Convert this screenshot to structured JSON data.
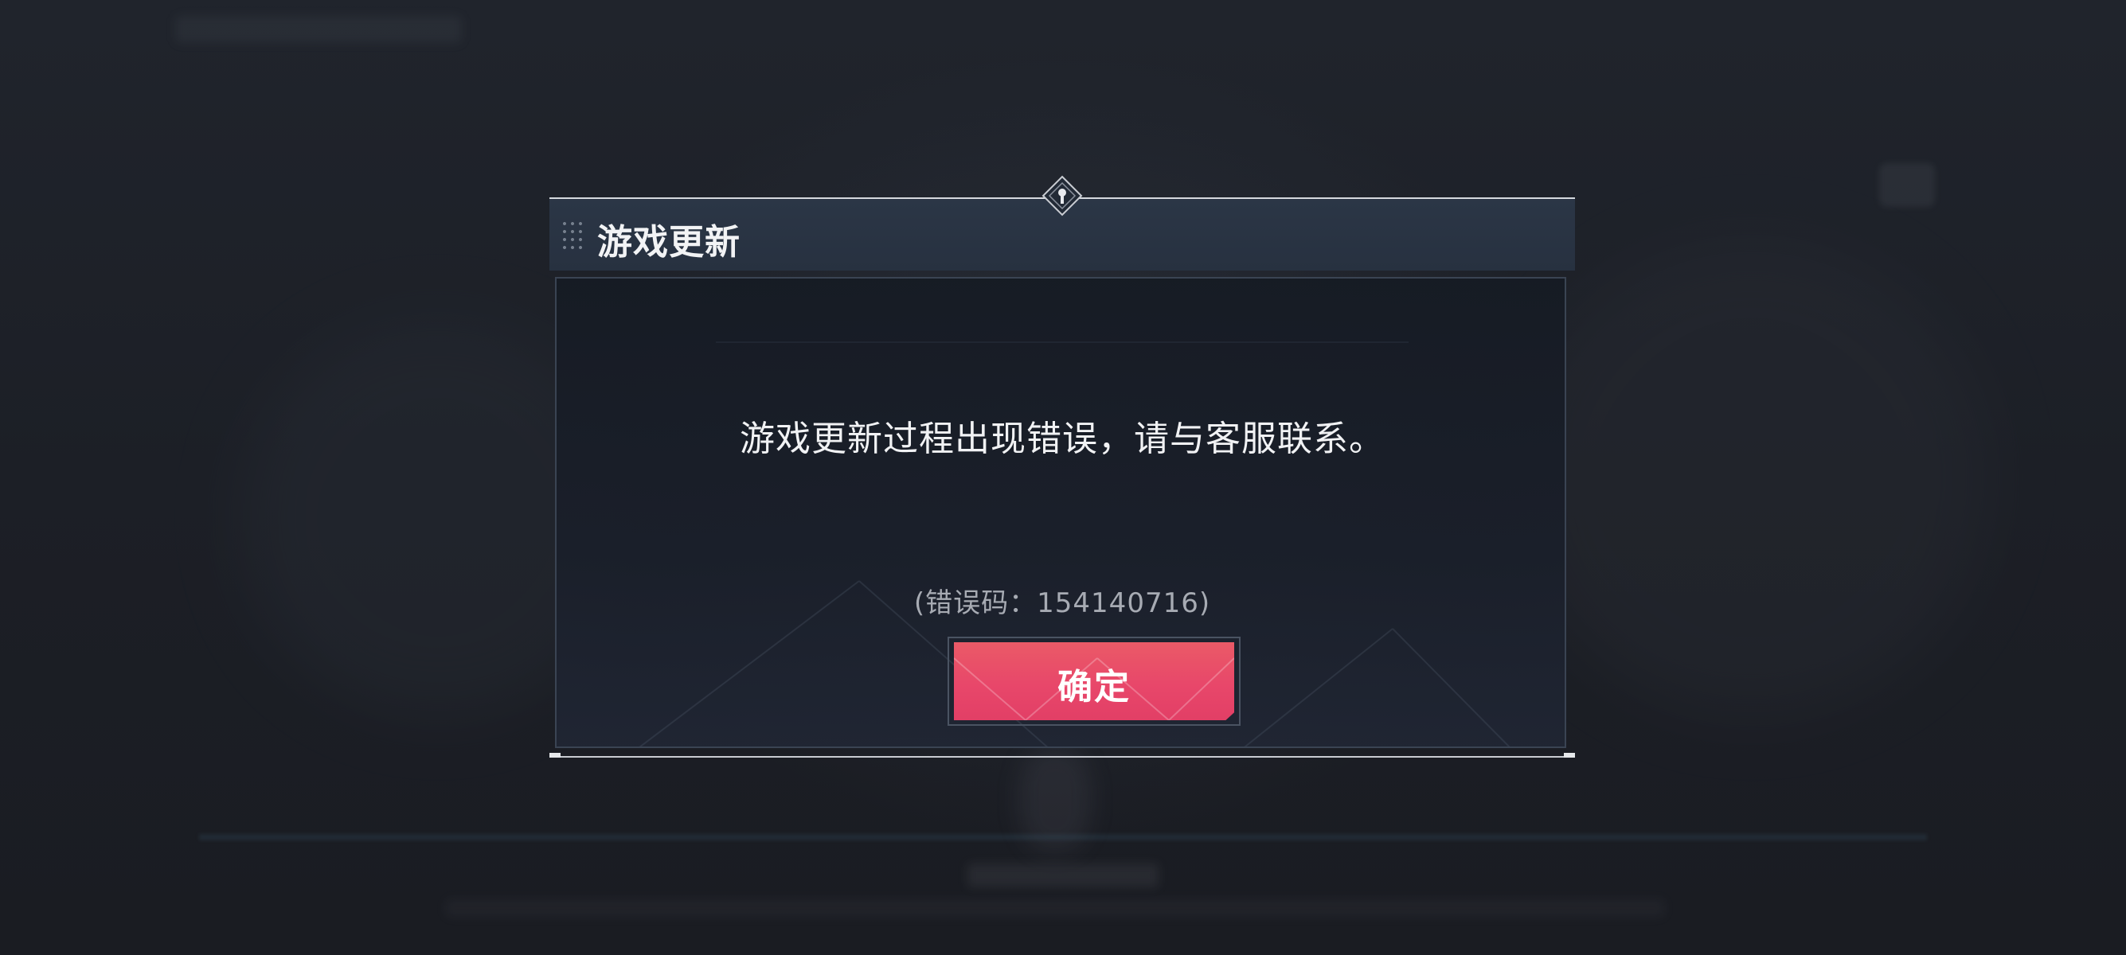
{
  "dialog": {
    "title": "游戏更新",
    "message": "游戏更新过程出现错误，请与客服联系。",
    "error_code": "(错误码：154140716)",
    "confirm_label": "确定"
  },
  "colors": {
    "header_bg": "#28323f",
    "confirm_button": "#e8476a",
    "text_primary": "#f1f2f4",
    "text_secondary": "#a7abb3"
  },
  "icons": {
    "emblem": "diamond-emblem-icon",
    "grip": "drag-grip-icon"
  }
}
